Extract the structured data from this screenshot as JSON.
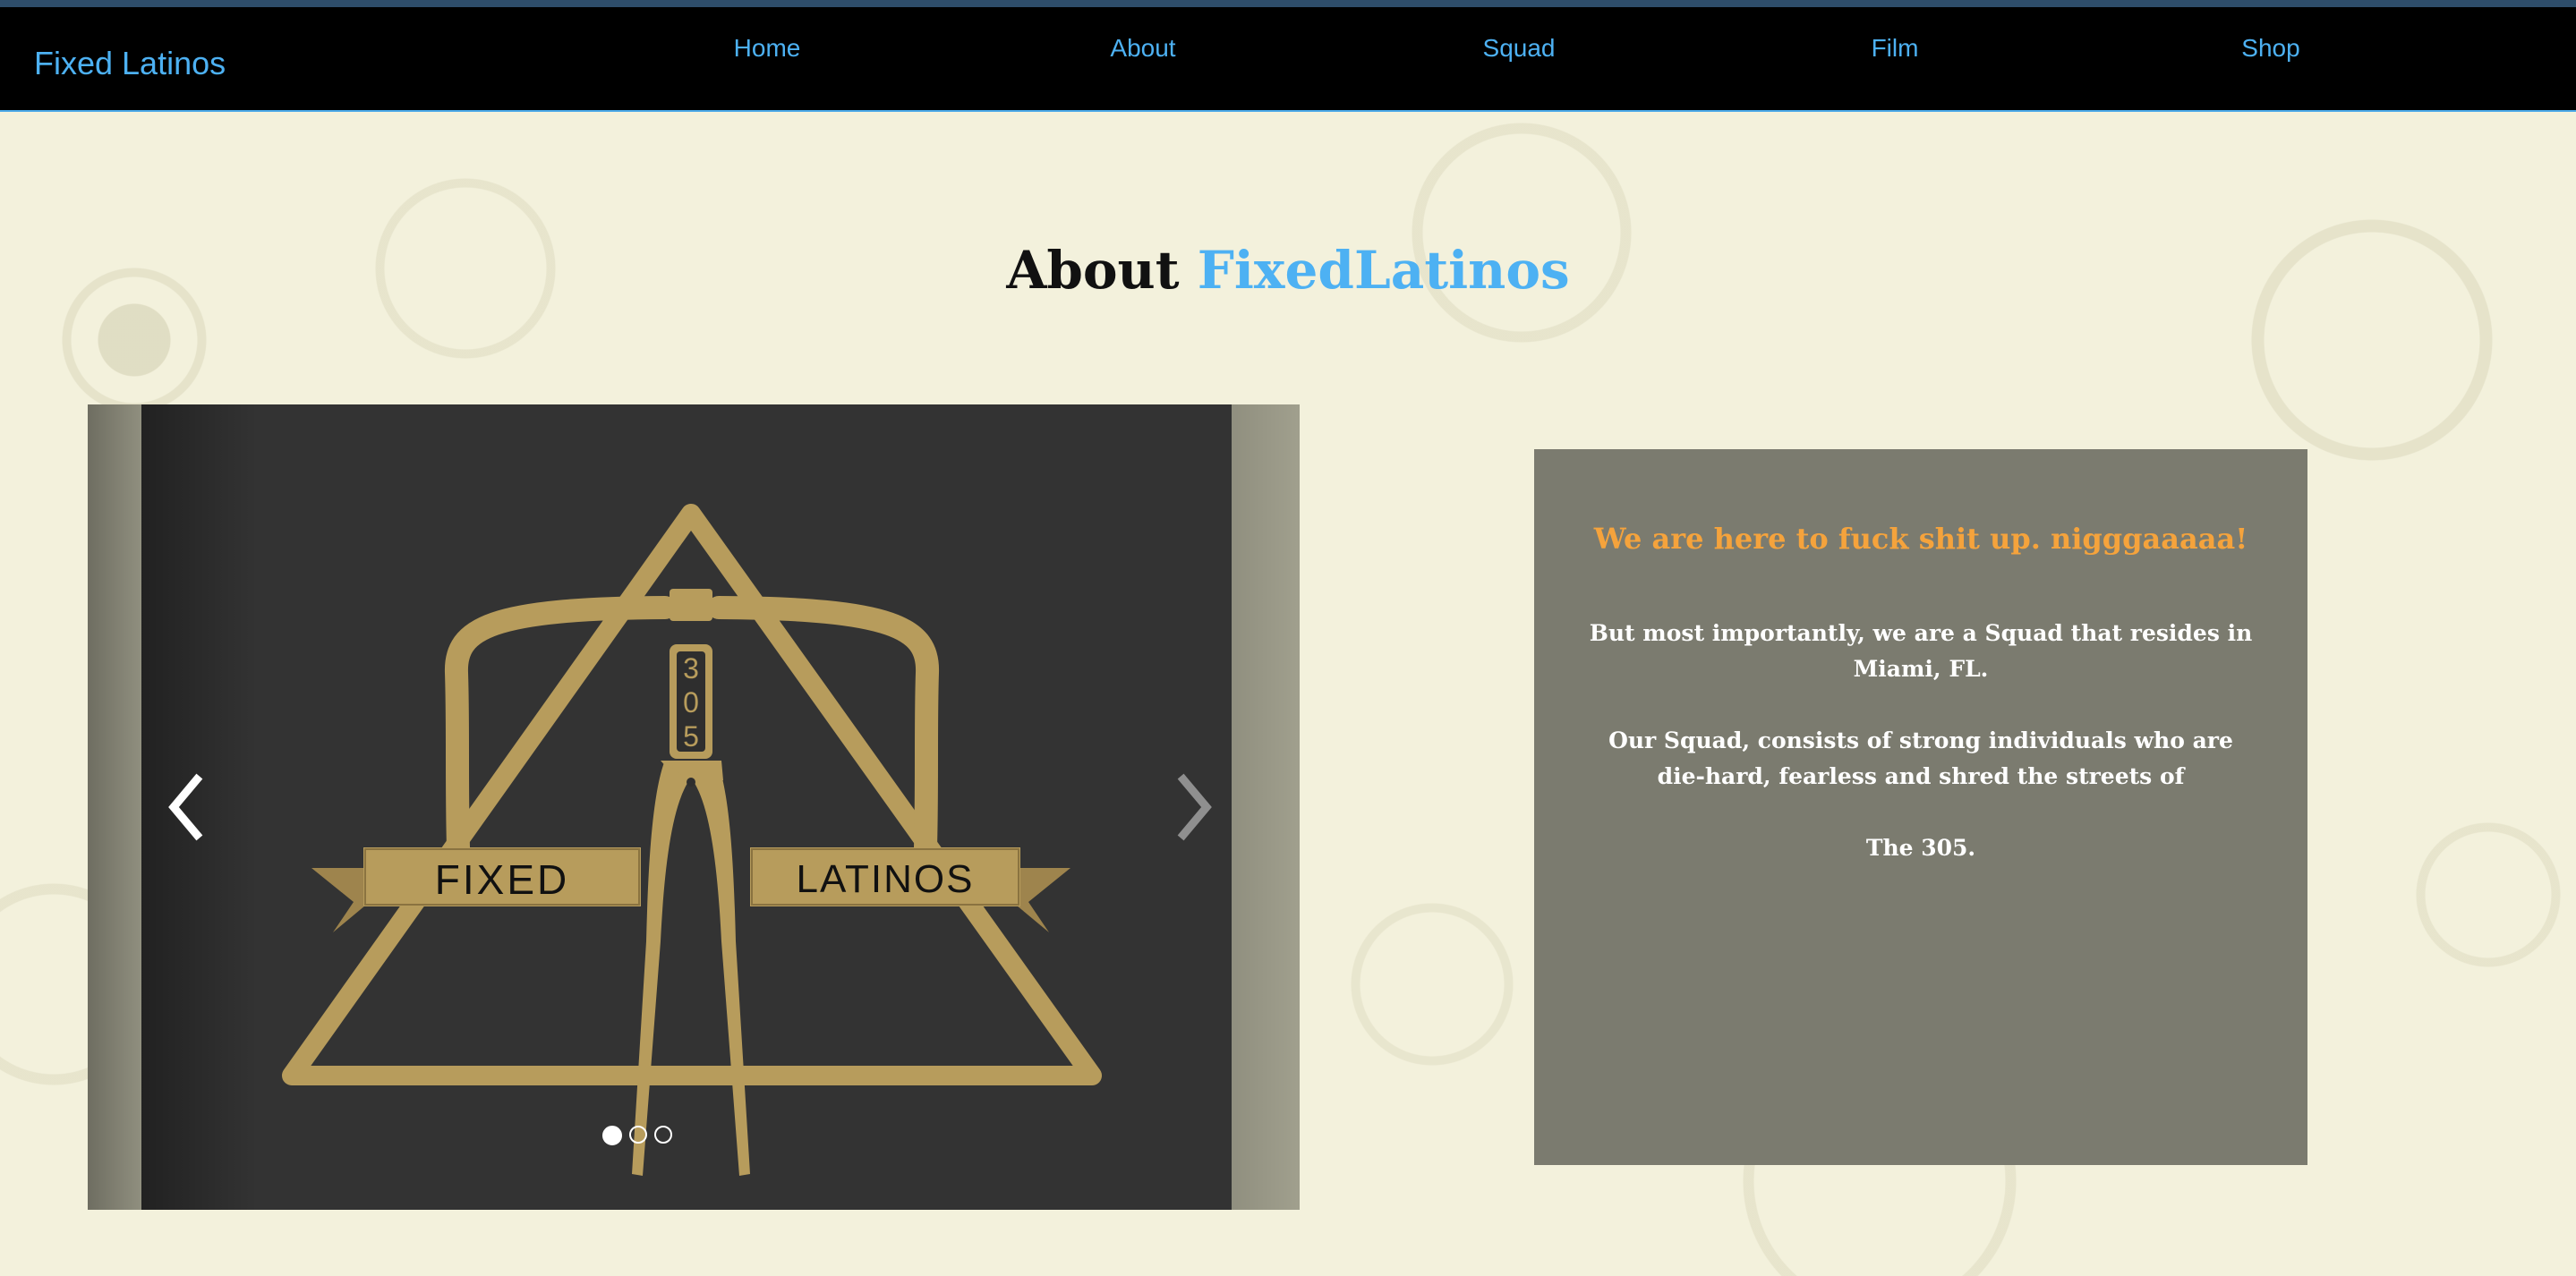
{
  "navbar": {
    "brand": "Fixed Latinos",
    "links": [
      "Home",
      "About",
      "Squad",
      "Film",
      "Shop"
    ]
  },
  "heading": {
    "part1": "About",
    "part2": "FixedLatinos"
  },
  "carousel": {
    "logo_text_left": "FIXED",
    "logo_text_right": "LATINOS",
    "logo_number": [
      "3",
      "0",
      "5"
    ],
    "prev_icon": "chevron-left-icon",
    "next_icon": "chevron-right-icon",
    "slide_count": 3,
    "active_slide": 1
  },
  "info": {
    "title": "We are here to fuck shit up. nigggaaaaa!",
    "line1": "But most importantly, we are a Squad that resides in Miami, FL.",
    "line2": "Our Squad, consists of strong individuals who are die-hard, fearless and shred the streets of",
    "line3": "The 305."
  },
  "colors": {
    "accent_blue": "#4db1f3",
    "accent_orange": "#f5a33c",
    "logo_gold": "#b79c5c",
    "panel_bg": "#7b7b6f"
  }
}
